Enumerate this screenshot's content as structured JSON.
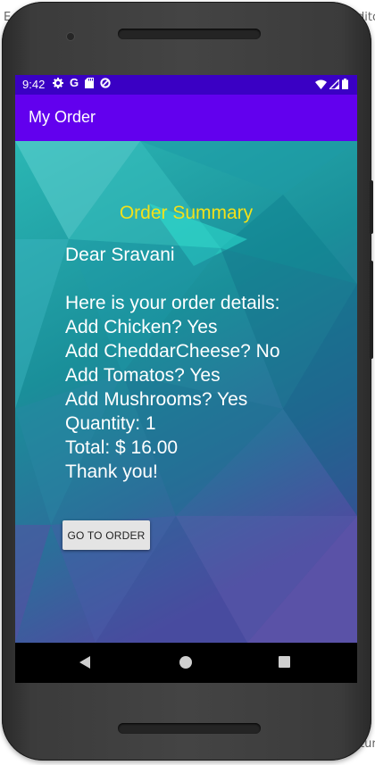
{
  "window_edge": {
    "left_char": "E",
    "right_top_text": "dito",
    "right_bottom_text": "tur"
  },
  "status_bar": {
    "time": "9:42",
    "icons": [
      "gear-icon",
      "google-icon",
      "sd-card-icon",
      "data-saver-icon"
    ],
    "right_icons": [
      "wifi-icon",
      "signal-icon",
      "battery-icon"
    ],
    "g_letter": "G"
  },
  "app_bar": {
    "title": "My Order",
    "color": "#6200ee"
  },
  "summary": {
    "title": "Order Summary",
    "title_color": "#f2e11a",
    "greeting": "Dear Sravani",
    "intro": "Here is your order details:",
    "lines": [
      "Add Chicken? Yes",
      "Add CheddarCheese? No",
      "Add Tomatos? Yes",
      "Add Mushrooms? Yes",
      "Quantity: 1",
      "Total: $ 16.00",
      "Thank you!"
    ]
  },
  "actions": {
    "go_to_order_label": "GO TO ORDER"
  },
  "nav": {
    "items": [
      "back-icon",
      "home-icon",
      "recents-icon"
    ]
  }
}
